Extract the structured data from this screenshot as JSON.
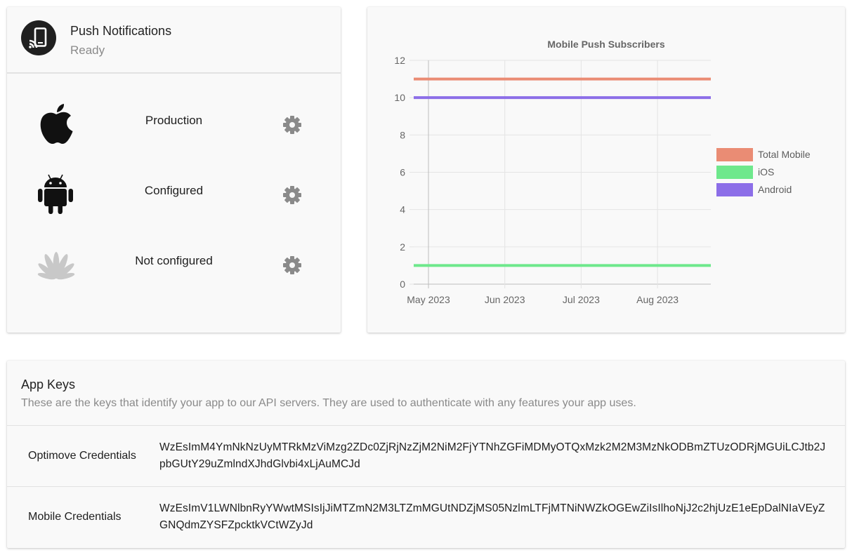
{
  "push": {
    "title": "Push Notifications",
    "status": "Ready",
    "avatar_icon": "push-device-icon",
    "platforms": [
      {
        "icon": "apple-icon",
        "status": "Production",
        "settings_icon": "gear-icon"
      },
      {
        "icon": "android-icon",
        "status": "Configured",
        "settings_icon": "gear-icon"
      },
      {
        "icon": "huawei-icon",
        "status": "Not configured",
        "settings_icon": "gear-icon"
      }
    ]
  },
  "chart_data": {
    "type": "line",
    "title": "Mobile Push Subscribers",
    "x": [
      "May 2023",
      "Jun 2023",
      "Jul 2023",
      "Aug 2023"
    ],
    "ylim": [
      0,
      12
    ],
    "yticks": [
      0,
      2,
      4,
      6,
      8,
      10,
      12
    ],
    "grid": true,
    "legend_position": "right",
    "series": [
      {
        "name": "Total Mobile",
        "color": "#ea8c74",
        "values": [
          11,
          11,
          11,
          11
        ]
      },
      {
        "name": "iOS",
        "color": "#6ee88c",
        "values": [
          1,
          1,
          1,
          1
        ]
      },
      {
        "name": "Android",
        "color": "#8c6ee8",
        "values": [
          10,
          10,
          10,
          10
        ]
      }
    ]
  },
  "keys": {
    "title": "App Keys",
    "description": "These are the keys that identify your app to our API servers. They are used to authenticate with any features your app uses.",
    "rows": [
      {
        "label": "Optimove Credentials",
        "value": "WzEsImM4YmNkNzUyMTRkMzViMzg2ZDc0ZjRjNzZjM2NiM2FjYTNhZGFiMDMyOTQxMzk2M2M3MzNkODBmZTUzODRjMGUiLCJtb2JpbGUtY29uZmlndXJhdGlvbi4xLjAuMCJd"
      },
      {
        "label": "Mobile Credentials",
        "value": "WzEsImV1LWNlbnRyYWwtMSIsIjJiMTZmN2M3LTZmMGUtNDZjMS05NzlmLTFjMTNiNWZkOGEwZiIsIlhoNjJ2c2hjUzE1eEpDalNIaVEyZGNQdmZYSFZpcktkVCtWZyJd"
      }
    ]
  }
}
